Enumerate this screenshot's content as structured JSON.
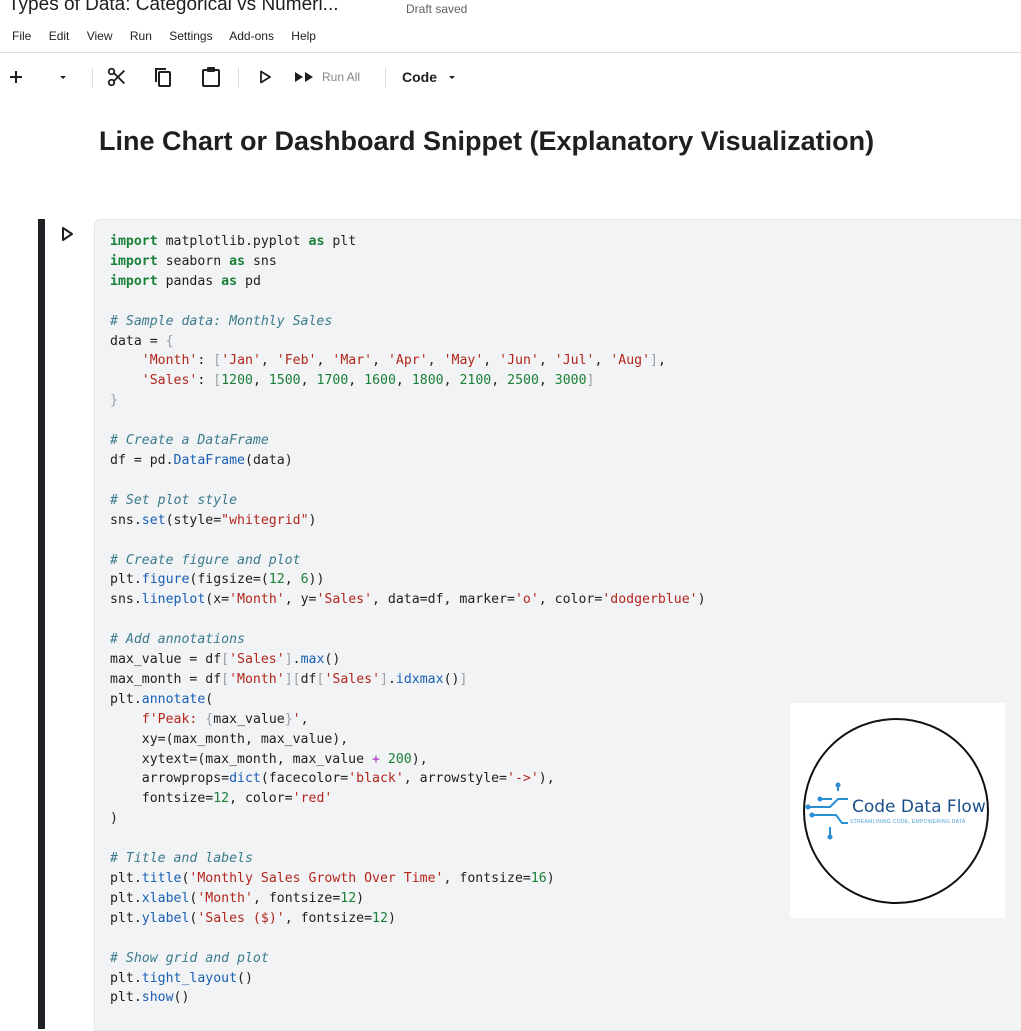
{
  "header": {
    "doc_title": "Types of Data: Categorical vs Numeri...",
    "status": "Draft saved"
  },
  "menu": [
    "File",
    "Edit",
    "View",
    "Run",
    "Settings",
    "Add-ons",
    "Help"
  ],
  "toolbar": {
    "run_all_label": "Run All",
    "cell_type": "Code",
    "icons": [
      "plus-icon",
      "chevron-down-icon",
      "scissors-icon",
      "copy-icon",
      "clipboard-icon",
      "play-icon",
      "fast-forward-icon"
    ]
  },
  "notebook": {
    "heading": "Line Chart or Dashboard Snippet (Explanatory Visualization)"
  },
  "code_lines": [
    "import matplotlib.pyplot as plt",
    "import seaborn as sns",
    "import pandas as pd",
    "",
    "# Sample data: Monthly Sales",
    "data = {",
    "    'Month': ['Jan', 'Feb', 'Mar', 'Apr', 'May', 'Jun', 'Jul', 'Aug'],",
    "    'Sales': [1200, 1500, 1700, 1600, 1800, 2100, 2500, 3000]",
    "}",
    "",
    "# Create a DataFrame",
    "df = pd.DataFrame(data)",
    "",
    "# Set plot style",
    "sns.set(style=\"whitegrid\")",
    "",
    "# Create figure and plot",
    "plt.figure(figsize=(12, 6))",
    "sns.lineplot(x='Month', y='Sales', data=df, marker='o', color='dodgerblue')",
    "",
    "# Add annotations",
    "max_value = df['Sales'].max()",
    "max_month = df['Month'][df['Sales'].idxmax()]",
    "plt.annotate(",
    "    f'Peak: {max_value}',",
    "    xy=(max_month, max_value),",
    "    xytext=(max_month, max_value + 200),",
    "    arrowprops=dict(facecolor='black', arrowstyle='->'),",
    "    fontsize=12, color='red'",
    ")",
    "",
    "# Title and labels",
    "plt.title('Monthly Sales Growth Over Time', fontsize=16)",
    "plt.xlabel('Month', fontsize=12)",
    "plt.ylabel('Sales ($)', fontsize=12)",
    "",
    "# Show grid and plot",
    "plt.tight_layout()",
    "plt.show()"
  ],
  "logo": {
    "name": "Code Data Flow",
    "tagline": "STREAMLINING CODE, EMPOWERING DATA"
  },
  "colors": {
    "keyword": "#1a7f37",
    "string": "#b3261e",
    "comment": "#3c7a8c",
    "function": "#1a5fb4",
    "editor_bg": "#f1f3f4",
    "logo_blue": "#1a4f8a"
  }
}
